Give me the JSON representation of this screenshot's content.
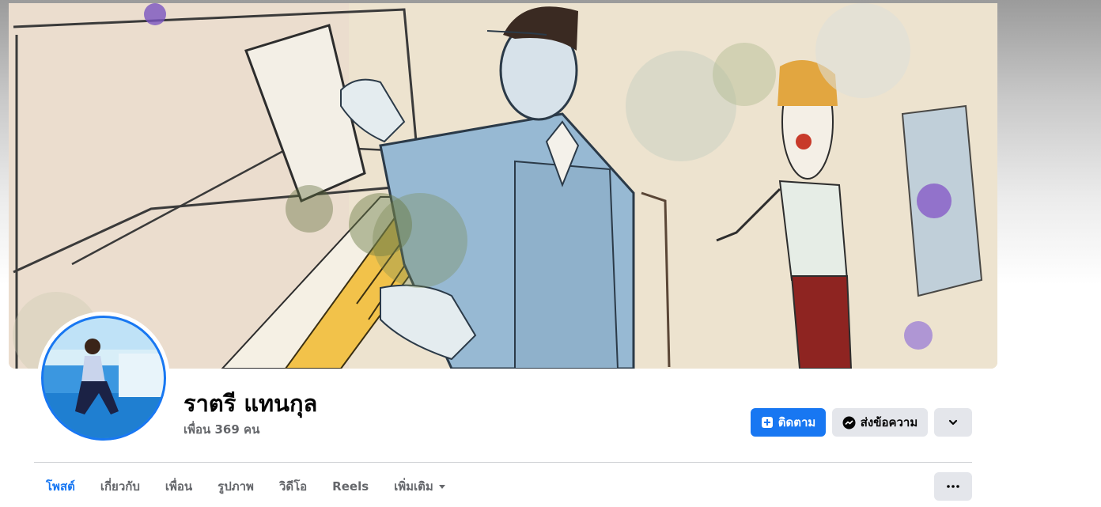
{
  "profile": {
    "name": "ราตรี แทนกุล",
    "friends": "เพื่อน 369 คน"
  },
  "actions": {
    "follow_label": "ติดตาม",
    "message_label": "ส่งข้อความ",
    "more_icon": "chevron-down-icon"
  },
  "tabs": [
    {
      "label": "โพสต์",
      "active": true
    },
    {
      "label": "เกี่ยวกับ"
    },
    {
      "label": "เพื่อน"
    },
    {
      "label": "รูปภาพ"
    },
    {
      "label": "วิดีโอ"
    },
    {
      "label": "Reels"
    },
    {
      "label": "เพิ่มเติม"
    }
  ],
  "colors": {
    "accent": "#1877f2",
    "secondary_button": "#e4e6eb",
    "muted_text": "#65676b"
  },
  "icons": {
    "follow": "follow-plus-icon",
    "message": "messenger-icon",
    "tab_more": "caret-down-icon",
    "overflow": "ellipsis-icon"
  }
}
